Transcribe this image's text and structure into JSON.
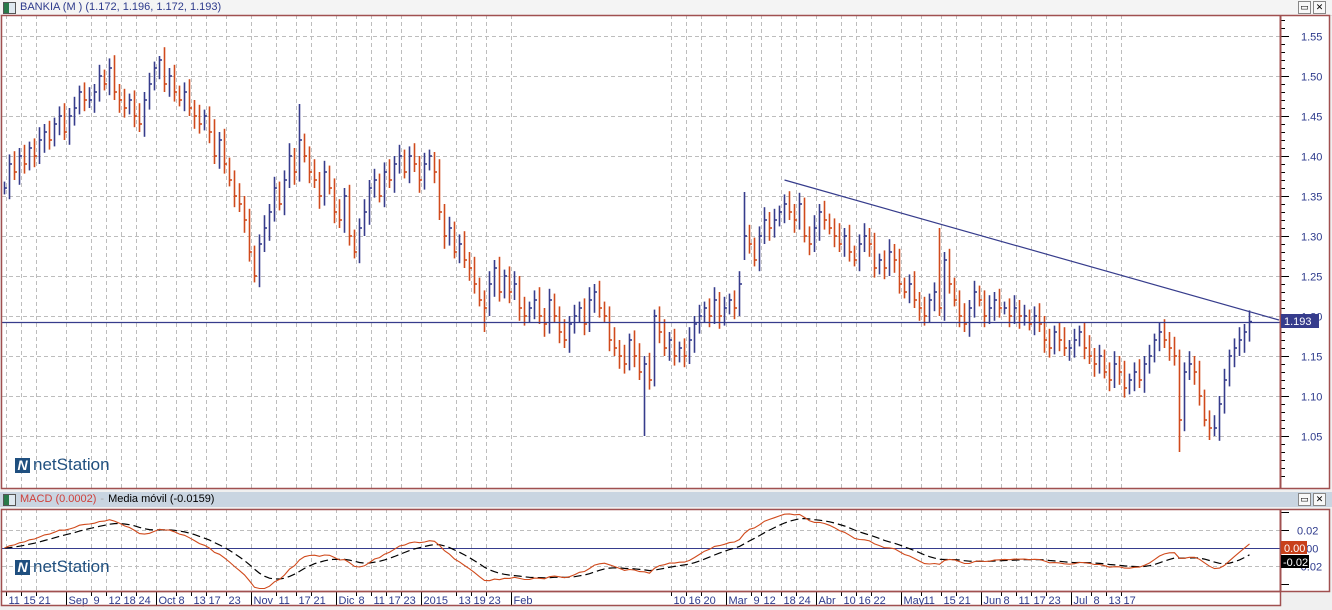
{
  "price_panel": {
    "symbol_title": "BANKIA (M ) (1.172, 1.196, 1.172, 1.193)",
    "last_price_label": "1.193",
    "last_price": 1.193,
    "y_ticks": [
      "1.55",
      "1.50",
      "1.45",
      "1.40",
      "1.35",
      "1.30",
      "1.25",
      "1.20",
      "1.15",
      "1.10",
      "1.05"
    ],
    "logo_text": "netStation",
    "trendline": {
      "start": [
        156,
        1.37
      ],
      "end": [
        255,
        1.195
      ]
    }
  },
  "macd_panel": {
    "macd_label": "MACD (0.0002)",
    "separator": "-",
    "signal_label": "Media móvil (-0.0159)",
    "y_ticks": [
      "0.02",
      "0.00",
      "-0.02"
    ],
    "macd_value_label": "0.00",
    "signal_value_label": "-0.02",
    "logo_text": "netStation"
  },
  "window_buttons": {
    "restore": "▭",
    "close": "✕"
  },
  "colors": {
    "up": "#363c8c",
    "down": "#d04a1c",
    "trend": "#363c8c",
    "grid": "#bdbdbd",
    "frame": "#a05050",
    "macd": "#d04a1c",
    "signal": "#000000"
  },
  "chart_data": {
    "type": "ohlc",
    "title": "BANKIA (M )",
    "ylim": [
      1.0,
      1.58
    ],
    "close": [
      1.36,
      1.39,
      1.38,
      1.4,
      1.39,
      1.41,
      1.4,
      1.42,
      1.43,
      1.42,
      1.44,
      1.45,
      1.43,
      1.45,
      1.46,
      1.48,
      1.47,
      1.47,
      1.48,
      1.5,
      1.49,
      1.51,
      1.48,
      1.47,
      1.46,
      1.47,
      1.45,
      1.44,
      1.47,
      1.49,
      1.51,
      1.52,
      1.49,
      1.5,
      1.48,
      1.47,
      1.48,
      1.46,
      1.45,
      1.44,
      1.45,
      1.43,
      1.4,
      1.42,
      1.39,
      1.37,
      1.35,
      1.34,
      1.32,
      1.28,
      1.25,
      1.29,
      1.31,
      1.33,
      1.36,
      1.34,
      1.37,
      1.4,
      1.38,
      1.42,
      1.4,
      1.38,
      1.37,
      1.35,
      1.38,
      1.36,
      1.33,
      1.32,
      1.35,
      1.3,
      1.28,
      1.31,
      1.33,
      1.36,
      1.37,
      1.35,
      1.38,
      1.37,
      1.39,
      1.4,
      1.38,
      1.4,
      1.39,
      1.37,
      1.39,
      1.4,
      1.38,
      1.33,
      1.3,
      1.31,
      1.28,
      1.29,
      1.27,
      1.26,
      1.24,
      1.22,
      1.21,
      1.24,
      1.26,
      1.23,
      1.25,
      1.23,
      1.24,
      1.21,
      1.2,
      1.21,
      1.22,
      1.2,
      1.19,
      1.22,
      1.2,
      1.18,
      1.17,
      1.19,
      1.2,
      1.21,
      1.19,
      1.22,
      1.23,
      1.21,
      1.2,
      1.17,
      1.16,
      1.15,
      1.14,
      1.17,
      1.15,
      1.13,
      1.14,
      1.12,
      1.2,
      1.18,
      1.16,
      1.17,
      1.15,
      1.16,
      1.15,
      1.17,
      1.19,
      1.2,
      1.21,
      1.2,
      1.22,
      1.2,
      1.21,
      1.22,
      1.21,
      1.24,
      1.3,
      1.29,
      1.27,
      1.3,
      1.32,
      1.31,
      1.32,
      1.33,
      1.34,
      1.33,
      1.32,
      1.34,
      1.3,
      1.29,
      1.31,
      1.33,
      1.32,
      1.31,
      1.3,
      1.29,
      1.3,
      1.28,
      1.27,
      1.29,
      1.3,
      1.29,
      1.26,
      1.27,
      1.26,
      1.28,
      1.27,
      1.24,
      1.23,
      1.24,
      1.22,
      1.21,
      1.2,
      1.22,
      1.23,
      1.21,
      1.27,
      1.24,
      1.22,
      1.2,
      1.19,
      1.21,
      1.23,
      1.22,
      1.2,
      1.21,
      1.22,
      1.21,
      1.21,
      1.2,
      1.21,
      1.2,
      1.2,
      1.19,
      1.2,
      1.19,
      1.17,
      1.16,
      1.18,
      1.17,
      1.16,
      1.16,
      1.17,
      1.18,
      1.16,
      1.15,
      1.14,
      1.15,
      1.13,
      1.12,
      1.14,
      1.13,
      1.11,
      1.12,
      1.13,
      1.12,
      1.14,
      1.15,
      1.17,
      1.18,
      1.17,
      1.16,
      1.15,
      1.07,
      1.13,
      1.14,
      1.13,
      1.1,
      1.07,
      1.06,
      1.06,
      1.09,
      1.12,
      1.15,
      1.16,
      1.17,
      1.18,
      1.193
    ],
    "low_overrides": {
      "96": 1.18,
      "128": 1.05,
      "148": 1.27,
      "235": 1.03,
      "241": 1.045
    },
    "high_overrides": {
      "148": 1.355,
      "187": 1.31,
      "31": 1.525,
      "59": 1.465,
      "86": 1.405
    },
    "x_labels": [
      {
        "text": "11",
        "idx": 1
      },
      {
        "text": "15",
        "idx": 4
      },
      {
        "text": "21",
        "idx": 7
      },
      {
        "text": "Sep",
        "idx": 13,
        "month": true
      },
      {
        "text": "9",
        "idx": 18
      },
      {
        "text": "12",
        "idx": 21
      },
      {
        "text": "18",
        "idx": 24
      },
      {
        "text": "24",
        "idx": 27
      },
      {
        "text": "Oct",
        "idx": 31,
        "month": true
      },
      {
        "text": "8",
        "idx": 35
      },
      {
        "text": "13",
        "idx": 38
      },
      {
        "text": "17",
        "idx": 41
      },
      {
        "text": "23",
        "idx": 45
      },
      {
        "text": "Nov",
        "idx": 50,
        "month": true
      },
      {
        "text": "11",
        "idx": 55
      },
      {
        "text": "17",
        "idx": 59
      },
      {
        "text": "21",
        "idx": 62
      },
      {
        "text": "Dic",
        "idx": 67,
        "month": true
      },
      {
        "text": "8",
        "idx": 71
      },
      {
        "text": "11",
        "idx": 74
      },
      {
        "text": "17",
        "idx": 77
      },
      {
        "text": "23",
        "idx": 80
      },
      {
        "text": "2015",
        "idx": 84,
        "month": true
      },
      {
        "text": "13",
        "idx": 91
      },
      {
        "text": "19",
        "idx": 94
      },
      {
        "text": "23",
        "idx": 97
      },
      {
        "text": "Feb",
        "idx": 102,
        "month": true
      },
      {
        "text": "10",
        "idx": 134
      },
      {
        "text": "16",
        "idx": 137
      },
      {
        "text": "20",
        "idx": 140
      },
      {
        "text": "Mar",
        "idx": 145,
        "month": true
      },
      {
        "text": "9",
        "idx": 150
      },
      {
        "text": "12",
        "idx": 152
      },
      {
        "text": "18",
        "idx": 156
      },
      {
        "text": "24",
        "idx": 159
      },
      {
        "text": "Abr",
        "idx": 163,
        "month": true
      },
      {
        "text": "10",
        "idx": 168
      },
      {
        "text": "16",
        "idx": 171
      },
      {
        "text": "22",
        "idx": 174
      },
      {
        "text": "May",
        "idx": 180,
        "month": true
      },
      {
        "text": "11",
        "idx": 184
      },
      {
        "text": "15",
        "idx": 188
      },
      {
        "text": "21",
        "idx": 191
      },
      {
        "text": "Jun",
        "idx": 196,
        "month": true
      },
      {
        "text": "8",
        "idx": 200
      },
      {
        "text": "11",
        "idx": 203
      },
      {
        "text": "17",
        "idx": 206
      },
      {
        "text": "23",
        "idx": 209
      },
      {
        "text": "Jul",
        "idx": 214,
        "month": true
      },
      {
        "text": "8",
        "idx": 218
      },
      {
        "text": "13",
        "idx": 221
      },
      {
        "text": "17",
        "idx": 224
      }
    ]
  }
}
